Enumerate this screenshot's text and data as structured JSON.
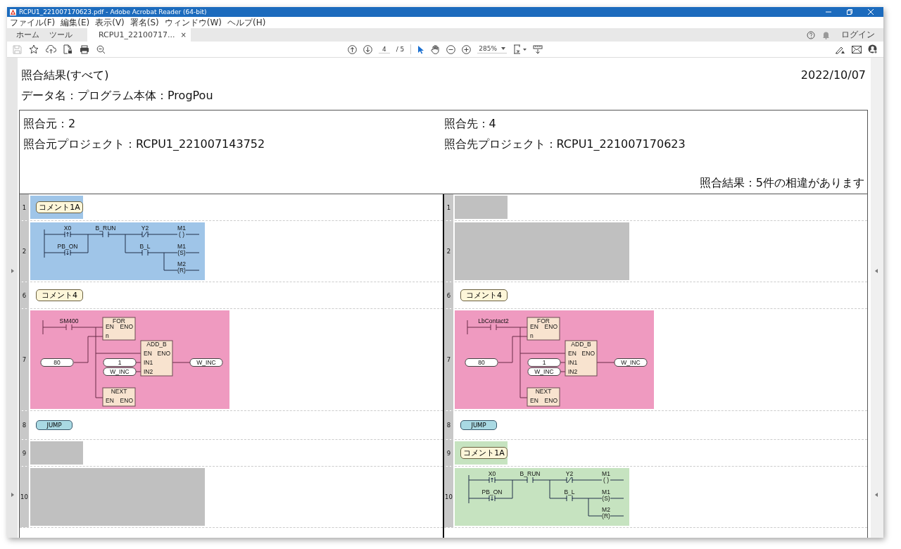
{
  "window": {
    "title": "RCPU1_221007170623.pdf - Adobe Acrobat Reader (64-bit)",
    "menu": [
      "ファイル(F)",
      "編集(E)",
      "表示(V)",
      "署名(S)",
      "ウィンドウ(W)",
      "ヘルプ(H)"
    ]
  },
  "tabs": [
    {
      "label": "ホーム",
      "selected": false
    },
    {
      "label": "ツール",
      "selected": false
    },
    {
      "label": "RCPU1_22100717...",
      "selected": true,
      "close": "×"
    }
  ],
  "account": {
    "login": "ログイン"
  },
  "toolbar": {
    "page_current": "4",
    "page_total": "/ 5",
    "zoom": "285%"
  },
  "report": {
    "title": "照合結果(すべて)",
    "date": "2022/10/07",
    "data_name": "データ名：プログラム本体：ProgPou",
    "source": {
      "label": "照合元：2",
      "project": "照合元プロジェクト：RCPU1_221007143752"
    },
    "target": {
      "label": "照合先：4",
      "project": "照合先プロジェクト：RCPU1_221007170623"
    },
    "result": "照合結果：5件の相違があります"
  },
  "comparison": {
    "sides": [
      {
        "rows": [
          {
            "number": "1",
            "kind": "comment",
            "color": "#9fc5e8",
            "text": "コメント1A"
          },
          {
            "number": "2",
            "kind": "ladder",
            "color": "#9fc5e8",
            "ladder": {
              "contacts": [
                {
                  "label": "X0",
                  "kind": "rise"
                },
                {
                  "label": "B_RUN",
                  "kind": "no"
                },
                {
                  "label": "Y2",
                  "kind": "nc"
                },
                {
                  "label": "PB_ON",
                  "kind": "fall"
                },
                {
                  "label": "B_L",
                  "kind": "no"
                }
              ],
              "coils": [
                {
                  "label": "M1",
                  "symbol": "( )"
                },
                {
                  "label": "M1",
                  "symbol": "(S)"
                },
                {
                  "label": "M2",
                  "symbol": "(R)"
                }
              ]
            }
          },
          {
            "number": "6",
            "kind": "comment",
            "text": "コメント4"
          },
          {
            "number": "7",
            "kind": "fb",
            "color": "#ef9ac0",
            "fb": {
              "contact": "SM400",
              "blocks": [
                {
                  "title": "FOR",
                  "pins": [
                    "EN",
                    "ENO",
                    "n"
                  ]
                },
                {
                  "title": "ADD_B",
                  "pins": [
                    "EN",
                    "ENO",
                    "IN1",
                    "IN2"
                  ]
                },
                {
                  "title": "NEXT",
                  "pins": [
                    "EN",
                    "ENO"
                  ]
                }
              ],
              "inputs": [
                "80",
                "1",
                "W_INC"
              ],
              "output": "W_INC"
            }
          },
          {
            "number": "8",
            "kind": "jump",
            "text": "JUMP"
          },
          {
            "number": "9",
            "kind": "blank",
            "color": "#c0c0c0"
          },
          {
            "number": "10",
            "kind": "blank",
            "color": "#c0c0c0"
          }
        ]
      },
      {
        "rows": [
          {
            "number": "1",
            "kind": "blank",
            "color": "#c0c0c0"
          },
          {
            "number": "2",
            "kind": "blank",
            "color": "#c0c0c0"
          },
          {
            "number": "6",
            "kind": "comment",
            "text": "コメント4"
          },
          {
            "number": "7",
            "kind": "fb",
            "color": "#ef9ac0",
            "fb": {
              "contact": "LbContact2",
              "blocks": [
                {
                  "title": "FOR",
                  "pins": [
                    "EN",
                    "ENO",
                    "n"
                  ]
                },
                {
                  "title": "ADD_B",
                  "pins": [
                    "EN",
                    "ENO",
                    "IN1",
                    "IN2"
                  ]
                },
                {
                  "title": "NEXT",
                  "pins": [
                    "EN",
                    "ENO"
                  ]
                }
              ],
              "inputs": [
                "80",
                "1",
                "W_INC"
              ],
              "output": "W_INC"
            }
          },
          {
            "number": "8",
            "kind": "jump",
            "text": "JUMP"
          },
          {
            "number": "9",
            "kind": "comment",
            "color": "#c6e3c0",
            "text": "コメント1A"
          },
          {
            "number": "10",
            "kind": "ladder",
            "color": "#c6e3c0",
            "ladder": {
              "contacts": [
                {
                  "label": "X0",
                  "kind": "rise"
                },
                {
                  "label": "B_RUN",
                  "kind": "no"
                },
                {
                  "label": "Y2",
                  "kind": "nc"
                },
                {
                  "label": "PB_ON",
                  "kind": "fall"
                },
                {
                  "label": "B_L",
                  "kind": "no"
                }
              ],
              "coils": [
                {
                  "label": "M1",
                  "symbol": "( )"
                },
                {
                  "label": "M1",
                  "symbol": "(S)"
                },
                {
                  "label": "M2",
                  "symbol": "(R)"
                }
              ]
            }
          }
        ]
      }
    ]
  }
}
